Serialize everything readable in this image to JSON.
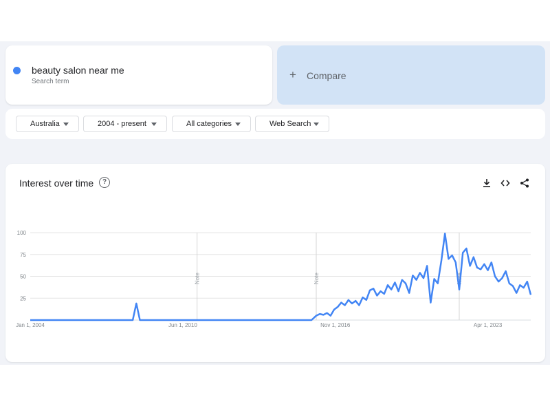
{
  "search_term": {
    "label": "beauty salon near me",
    "sublabel": "Search term",
    "color": "#4285f4"
  },
  "compare": {
    "plus": "+",
    "label": "Compare"
  },
  "filters": [
    {
      "label": "Australia"
    },
    {
      "label": "2004 - present"
    },
    {
      "label": "All categories"
    },
    {
      "label": "Web Search"
    }
  ],
  "chart_section": {
    "title": "Interest over time",
    "help_icon": "help-circle-icon",
    "actions": [
      "download-icon",
      "embed-code-icon",
      "share-icon"
    ]
  },
  "chart_data": {
    "type": "line",
    "x_tick_labels": [
      "Jan 1, 2004",
      "Jun 1, 2010",
      "Nov 1, 2016",
      "Apr 1, 2023"
    ],
    "y_tick_labels": [
      "100",
      "75",
      "50",
      "25"
    ],
    "ylim": [
      0,
      100
    ],
    "xlim": [
      2004.0,
      2025.0
    ],
    "note_markers": [
      {
        "x": 2011.0,
        "label": "Note"
      },
      {
        "x": 2016.0,
        "label": "Note"
      },
      {
        "x": 2022.0,
        "label": "Note"
      }
    ],
    "series": [
      {
        "color": "#4285f4",
        "points": [
          [
            2004.0,
            0
          ],
          [
            2008.3,
            0
          ],
          [
            2008.45,
            19
          ],
          [
            2008.6,
            0
          ],
          [
            2015.8,
            0
          ],
          [
            2016.0,
            5
          ],
          [
            2016.15,
            7
          ],
          [
            2016.3,
            6
          ],
          [
            2016.45,
            8
          ],
          [
            2016.6,
            5
          ],
          [
            2016.75,
            12
          ],
          [
            2016.9,
            15
          ],
          [
            2017.05,
            20
          ],
          [
            2017.2,
            17
          ],
          [
            2017.35,
            23
          ],
          [
            2017.5,
            19
          ],
          [
            2017.65,
            22
          ],
          [
            2017.8,
            17
          ],
          [
            2017.95,
            26
          ],
          [
            2018.1,
            23
          ],
          [
            2018.25,
            34
          ],
          [
            2018.4,
            36
          ],
          [
            2018.55,
            28
          ],
          [
            2018.7,
            33
          ],
          [
            2018.85,
            30
          ],
          [
            2019.0,
            40
          ],
          [
            2019.15,
            35
          ],
          [
            2019.3,
            43
          ],
          [
            2019.45,
            33
          ],
          [
            2019.6,
            46
          ],
          [
            2019.75,
            42
          ],
          [
            2019.9,
            31
          ],
          [
            2020.05,
            51
          ],
          [
            2020.2,
            46
          ],
          [
            2020.35,
            54
          ],
          [
            2020.5,
            48
          ],
          [
            2020.65,
            62
          ],
          [
            2020.8,
            20
          ],
          [
            2020.95,
            47
          ],
          [
            2021.1,
            42
          ],
          [
            2021.25,
            68
          ],
          [
            2021.4,
            99
          ],
          [
            2021.55,
            70
          ],
          [
            2021.7,
            74
          ],
          [
            2021.85,
            66
          ],
          [
            2022.0,
            35
          ],
          [
            2022.15,
            77
          ],
          [
            2022.3,
            82
          ],
          [
            2022.45,
            62
          ],
          [
            2022.6,
            72
          ],
          [
            2022.75,
            60
          ],
          [
            2022.9,
            58
          ],
          [
            2023.05,
            64
          ],
          [
            2023.2,
            57
          ],
          [
            2023.35,
            66
          ],
          [
            2023.5,
            50
          ],
          [
            2023.65,
            44
          ],
          [
            2023.8,
            48
          ],
          [
            2023.95,
            56
          ],
          [
            2024.1,
            42
          ],
          [
            2024.25,
            39
          ],
          [
            2024.4,
            31
          ],
          [
            2024.55,
            40
          ],
          [
            2024.7,
            37
          ],
          [
            2024.85,
            44
          ],
          [
            2025.0,
            29
          ]
        ]
      }
    ],
    "grid": true
  }
}
